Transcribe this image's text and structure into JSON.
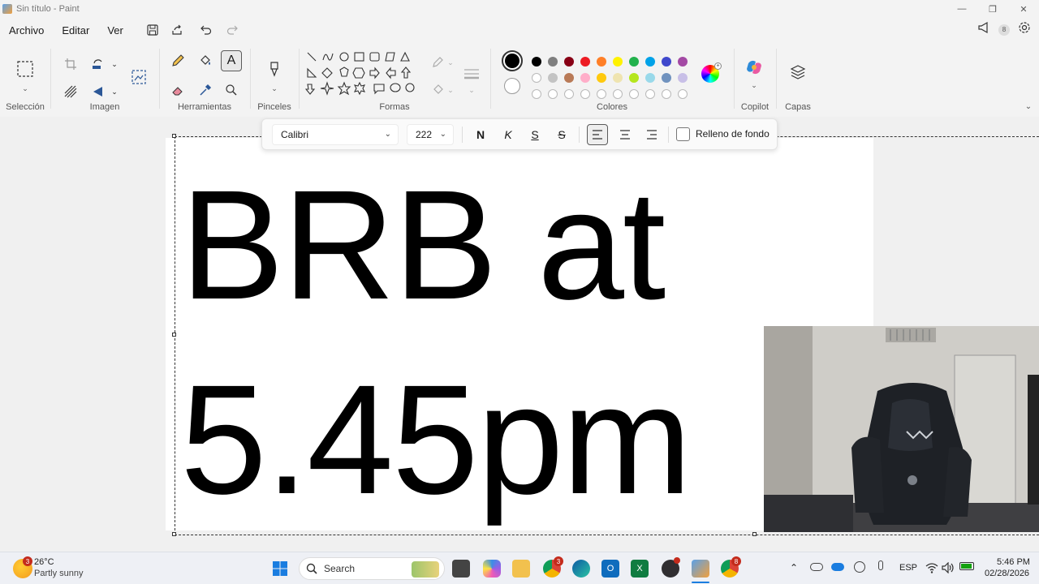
{
  "window": {
    "title": "Sin título - Paint"
  },
  "menu": {
    "items": [
      "Archivo",
      "Editar",
      "Ver"
    ]
  },
  "ribbon": {
    "groups": {
      "selection": "Selección",
      "image": "Imagen",
      "tools": "Herramientas",
      "brushes": "Pinceles",
      "shapes": "Formas",
      "colors": "Colores",
      "copilot": "Copilot",
      "layers": "Capas"
    },
    "notification_count": "8",
    "palette_row1": [
      "#000000",
      "#7f7f7f",
      "#880015",
      "#ed1c24",
      "#ff7f27",
      "#fff200",
      "#22b14c",
      "#00a2e8",
      "#3f48cc",
      "#a349a4"
    ],
    "palette_row2": [
      "#ffffff",
      "#c3c3c3",
      "#b97a57",
      "#ffaec9",
      "#ffc90e",
      "#efe4b0",
      "#b5e61d",
      "#99d9ea",
      "#7092be",
      "#c8bfe7"
    ]
  },
  "text_toolbar": {
    "font": "Calibri",
    "size": "222",
    "bold": "N",
    "italic": "K",
    "underline": "S",
    "strike": "S",
    "fill_label": "Relleno de fondo"
  },
  "canvas": {
    "line1": "BRB at",
    "line2": "5.45pm"
  },
  "taskbar": {
    "weather_temp": "26°C",
    "weather_desc": "Partly sunny",
    "weather_badge": "3",
    "search_placeholder": "Search",
    "language": "ESP",
    "time": "5:46 PM",
    "date": "02/28/2026",
    "chrome_badge": "3",
    "chrome2_badge": "8"
  }
}
